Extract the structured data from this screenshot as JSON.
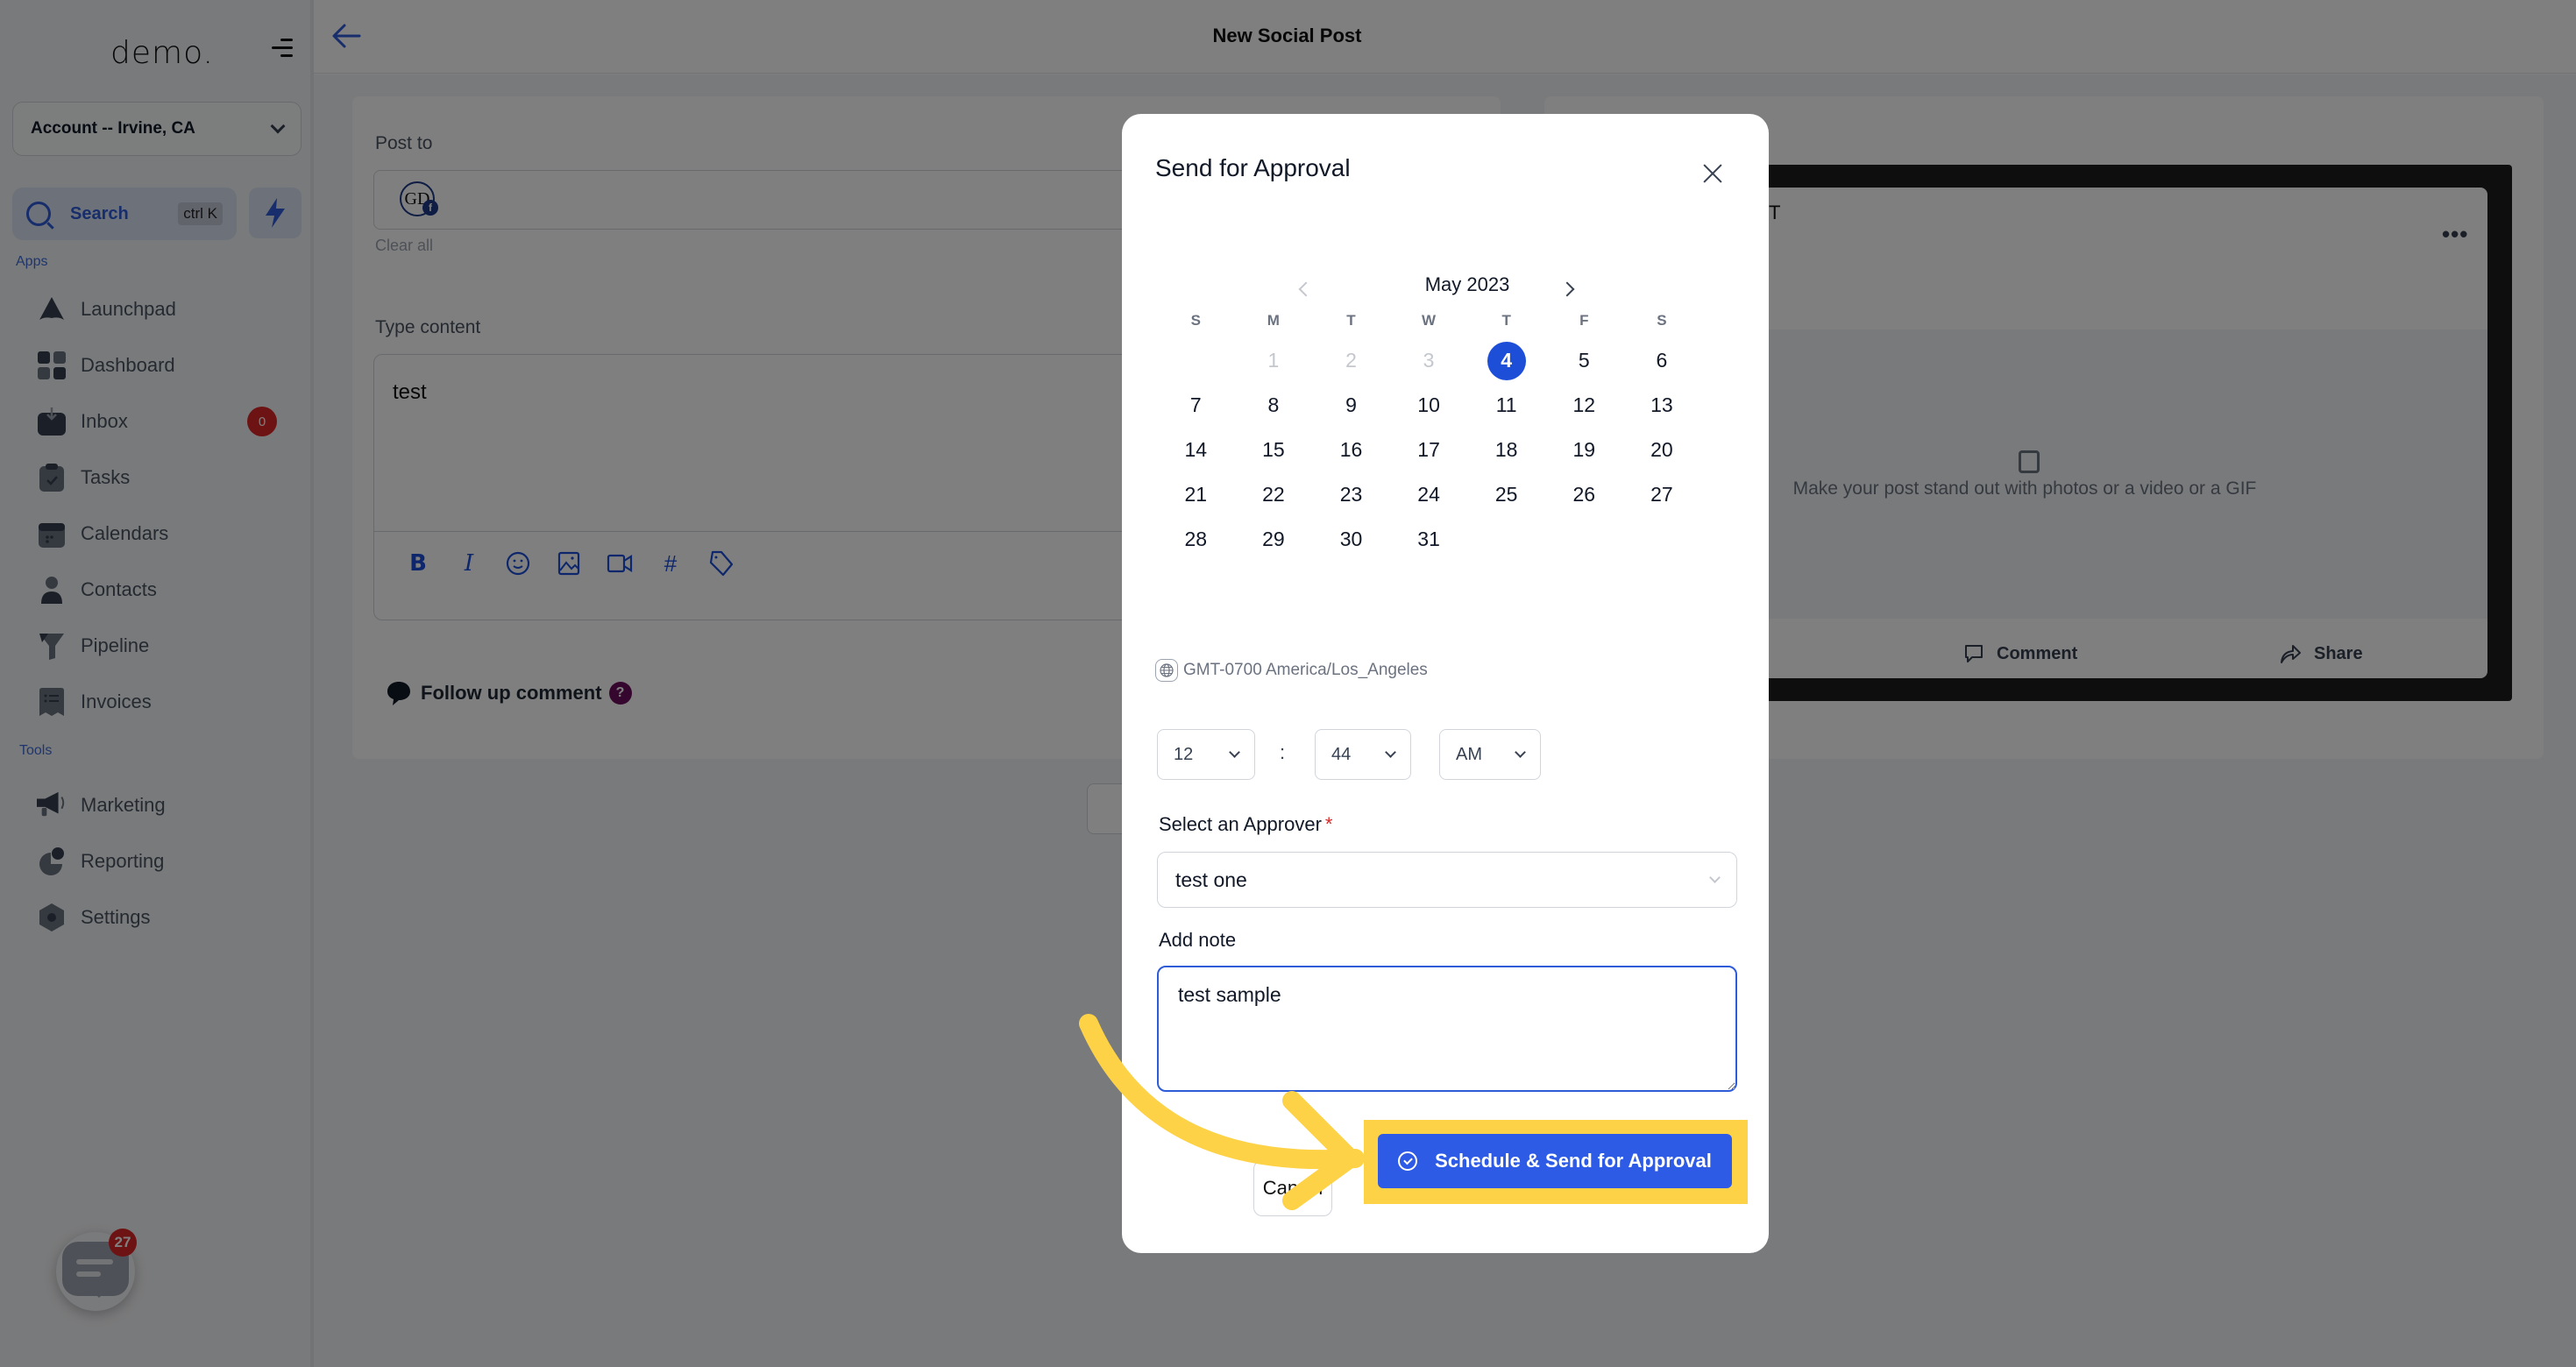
{
  "sidebar": {
    "logo": "demo.",
    "account": "Account -- Irvine, CA",
    "search_label": "Search",
    "search_shortcut": "ctrl K",
    "apps_title": "Apps",
    "tools_title": "Tools",
    "apps": [
      {
        "label": "Launchpad",
        "icon": "rocket-icon"
      },
      {
        "label": "Dashboard",
        "icon": "grid-icon"
      },
      {
        "label": "Inbox",
        "icon": "inbox-icon",
        "badge": "0"
      },
      {
        "label": "Tasks",
        "icon": "clipboard-check-icon"
      },
      {
        "label": "Calendars",
        "icon": "calendar-icon"
      },
      {
        "label": "Contacts",
        "icon": "person-icon"
      },
      {
        "label": "Pipeline",
        "icon": "funnel-icon"
      },
      {
        "label": "Invoices",
        "icon": "receipt-icon"
      }
    ],
    "tools": [
      {
        "label": "Marketing",
        "icon": "megaphone-icon"
      },
      {
        "label": "Reporting",
        "icon": "pie-chart-icon"
      },
      {
        "label": "Settings",
        "icon": "gear-icon"
      }
    ],
    "chat_badge": "27"
  },
  "header": {
    "title": "New Social Post"
  },
  "editor": {
    "post_to_label": "Post to",
    "account_avatar": "GD",
    "clear_all": "Clear all",
    "content_label": "Type content",
    "content_value": "test",
    "follow_up": "Follow up comment",
    "help": "?"
  },
  "preview": {
    "name_fragment": "ICT",
    "media_placeholder": "Make your post stand out with photos or a video or a GIF",
    "comment": "Comment",
    "share": "Share"
  },
  "modal": {
    "title": "Send for Approval",
    "calendar": {
      "month": "May 2023",
      "weekdays": [
        "S",
        "M",
        "T",
        "W",
        "T",
        "F",
        "S"
      ],
      "leading_blanks": 1,
      "days_in_month": 31,
      "disabled_days": [
        1,
        2,
        3
      ],
      "selected_day": 4
    },
    "timezone": "GMT-0700 America/Los_Angeles",
    "time": {
      "hour": "12",
      "minute": "44",
      "period": "AM",
      "separator": ":"
    },
    "approver_label": "Select an Approver",
    "required_mark": "*",
    "approver_value": "test one",
    "note_label": "Add note",
    "note_value": "test sample",
    "cancel_label": "Cancel",
    "submit_label": "Schedule & Send for Approval"
  },
  "colors": {
    "accent": "#2e5be6",
    "highlight": "#fdd246",
    "badge": "#dc2626"
  }
}
